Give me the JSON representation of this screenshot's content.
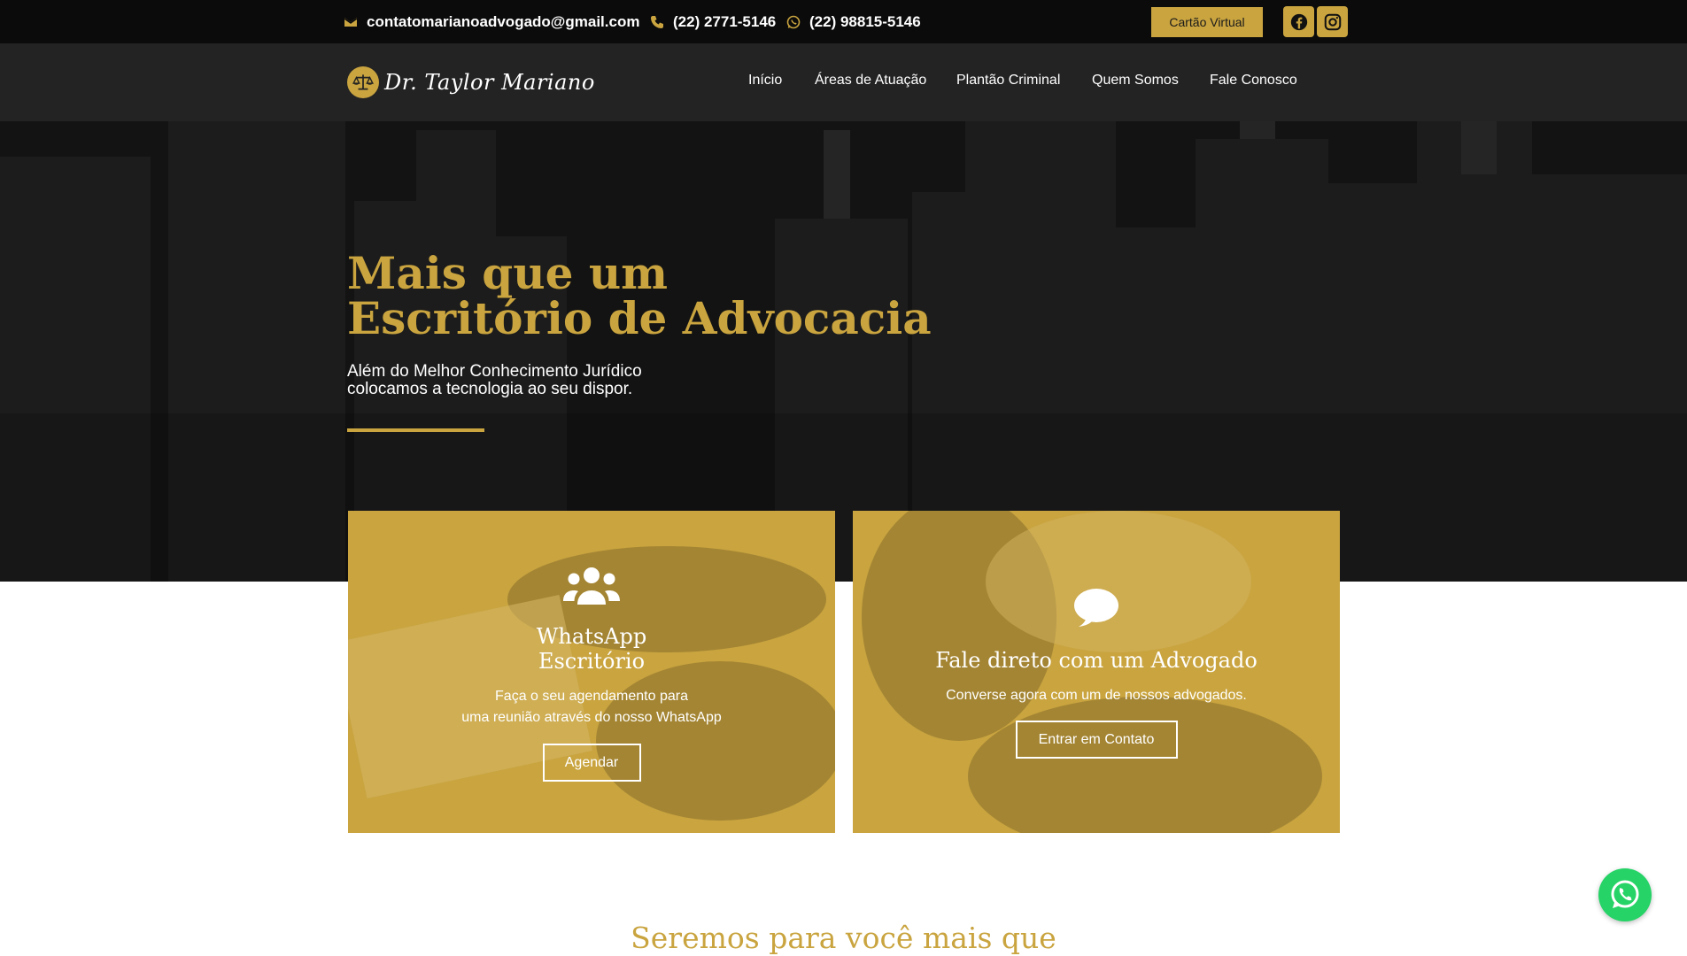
{
  "topbar": {
    "email": "contatomarianoadvogado@gmail.com",
    "phone": "(22) 2771-5146",
    "whatsapp": "(22) 98815-5146",
    "card_button": "Cartão Virtual",
    "icons": [
      "envelope-icon",
      "phone-icon",
      "whatsapp-icon",
      "facebook-icon",
      "instagram-icon"
    ]
  },
  "nav": {
    "logo_text": "Dr. Taylor Mariano",
    "items": [
      "Início",
      "Áreas de Atuação",
      "Plantão Criminal",
      "Quem Somos",
      "Fale Conosco"
    ]
  },
  "hero": {
    "title_line1": "Mais que um",
    "title_line2": "Escritório de Advocacia",
    "subtitle_line1": "Além do Melhor Conhecimento Jurídico",
    "subtitle_line2": "colocamos a tecnologia ao seu dispor."
  },
  "cards": [
    {
      "title_line1": "WhatsApp",
      "title_line2": "Escritório",
      "text_line1": "Faça o seu agendamento para",
      "text_line2": "uma reunião através do nosso WhatsApp",
      "button": "Agendar",
      "icon": "users-icon"
    },
    {
      "title": "Fale direto com um Advogado",
      "text": "Converse agora com um de nossos advogados.",
      "button": "Entrar em Contato",
      "icon": "chat-bubble-icon"
    }
  ],
  "section": {
    "heading": "Seremos para você mais que"
  },
  "colors": {
    "gold": "#c9a43f",
    "topbar": "#0b0b0b",
    "navbar": "#232323",
    "whatsapp": "#25d366"
  }
}
